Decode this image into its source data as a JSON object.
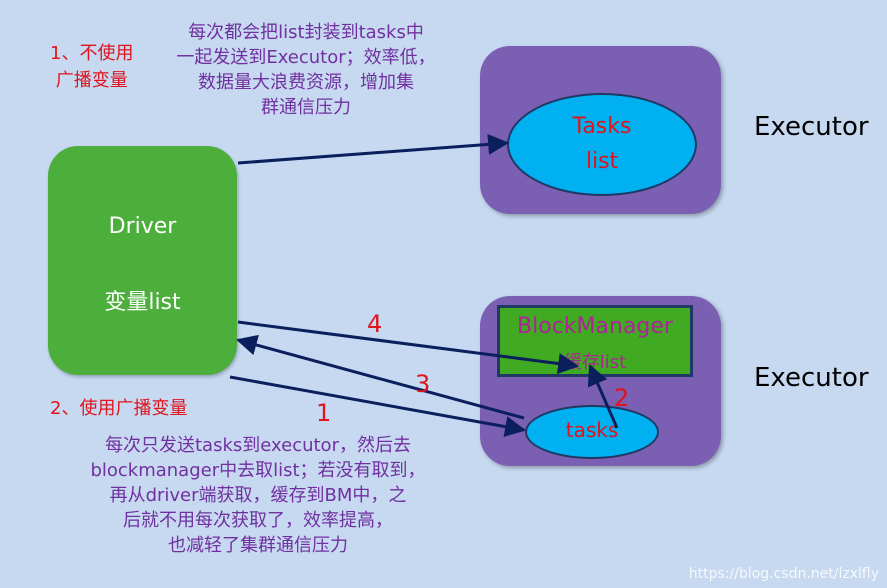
{
  "top_note": {
    "label": "1、不使用\n广播变量",
    "desc": "每次都会把list封装到tasks中\n一起发送到Executor；效率低，\n数据量大浪费资源，增加集\n群通信压力"
  },
  "bottom_note": {
    "label": "2、使用广播变量",
    "desc": "每次只发送tasks到executor，然后去\nblockmanager中去取list；若没有取到，\n再从driver端获取，缓存到BM中，之\n后就不用每次获取了，效率提高，\n也减轻了集群通信压力"
  },
  "driver": {
    "title": "Driver",
    "subtitle": "变量list"
  },
  "executor1": {
    "label": "Executor",
    "ellipse_line1": "Tasks",
    "ellipse_line2": "list"
  },
  "executor2": {
    "label": "Executor",
    "blockmanager_title": "BlockManager",
    "blockmanager_sub": "缓存list",
    "task_label": "tasks"
  },
  "steps": {
    "one": "1",
    "two": "2",
    "three": "3",
    "four": "4"
  },
  "watermark": "https://blog.csdn.net/lzxlfly",
  "colors": {
    "background": "#c6d9f1",
    "driver": "#4caf3c",
    "executor": "#7b5fb3",
    "ellipse": "#00b0f0",
    "arrow": "#0a1f5c",
    "red_text": "#e0141c",
    "purple_text": "#7030a0"
  }
}
